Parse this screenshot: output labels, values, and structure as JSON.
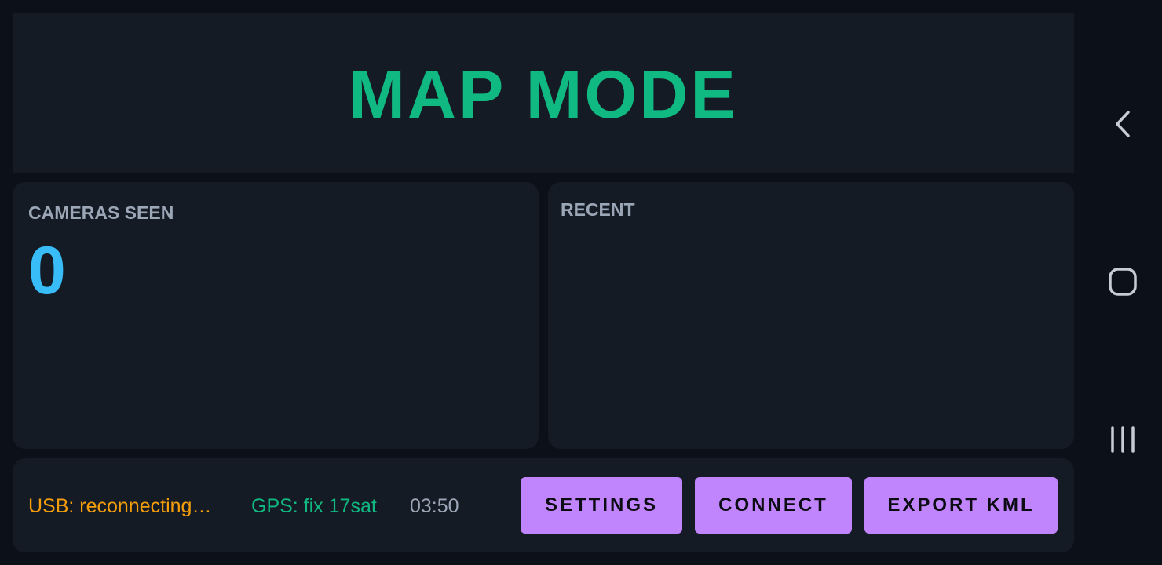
{
  "header": {
    "title": "MAP MODE"
  },
  "cameras": {
    "label": "CAMERAS SEEN",
    "count": "0"
  },
  "recent": {
    "label": "RECENT",
    "items": []
  },
  "status": {
    "usb": "USB: reconnecting…",
    "gps": "GPS: fix 17sat",
    "time": "03:50"
  },
  "actions": {
    "settings_label": "SETTINGS",
    "connect_label": "CONNECT",
    "export_label": "EXPORT KML"
  },
  "navigation": {
    "back_icon": "chevron-left-icon",
    "home_icon": "rounded-square-icon",
    "recents_icon": "three-bars-icon"
  },
  "colors": {
    "background": "#0c1018",
    "panel": "#151b25",
    "accent_green": "#10b981",
    "count_blue": "#38bdf8",
    "usb_orange": "#f59e0b",
    "button_purple": "#c084fc",
    "label_gray": "#9ba6b6"
  }
}
